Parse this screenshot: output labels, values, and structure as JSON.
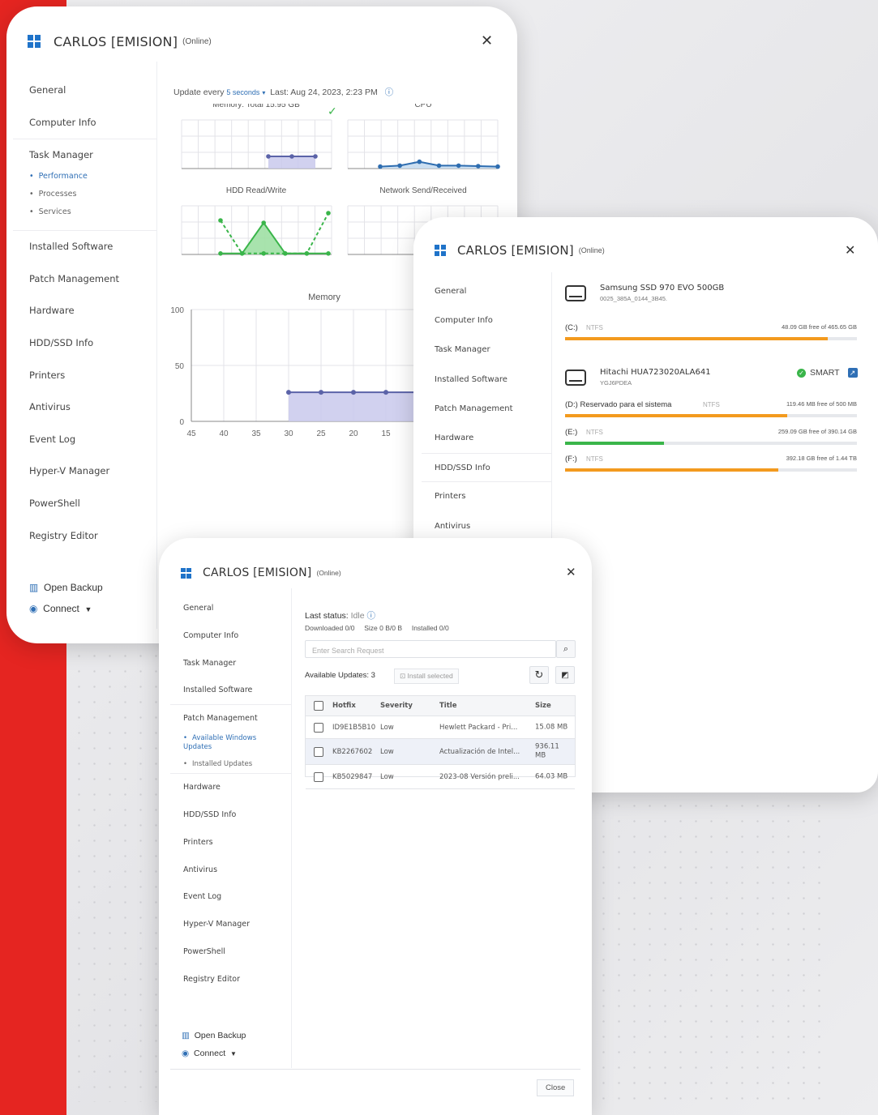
{
  "colors": {
    "brand_red": "#e52521",
    "accent_blue": "#2f6fb5",
    "chart_fill": "#c9c9ec",
    "chart_line": "#5b63a8",
    "hdd_green": "#3ab54a",
    "net_red": "#e84d6c",
    "bar_orange": "#f39a1e",
    "bar_green": "#3ab54a"
  },
  "windows": {
    "taskmgr": {
      "title": "CARLOS [EMISION]",
      "status": "(Online)",
      "close": "✕",
      "nav": [
        "General",
        "Computer Info",
        "Task Manager",
        "Installed Software",
        "Patch Management",
        "Hardware",
        "HDD/SSD Info",
        "Printers",
        "Antivirus",
        "Event Log",
        "Hyper-V Manager",
        "PowerShell",
        "Registry Editor"
      ],
      "sub": [
        "Performance",
        "Processes",
        "Services"
      ],
      "footer": {
        "backup": "Open Backup",
        "connect": "Connect"
      },
      "update_prefix": "Update every",
      "update_interval": "5 seconds",
      "last_label": "Last: Aug 24, 2023, 2:23 PM",
      "charts": {
        "memory_small": "Memory: Total 15.95 GB",
        "cpu": "CPU",
        "hdd": "HDD Read/Write",
        "net": "Network Send/Received",
        "memory_big": "Memory"
      }
    },
    "hdd": {
      "title": "CARLOS [EMISION]",
      "status": "(Online)",
      "close": "✕",
      "nav": [
        "General",
        "Computer Info",
        "Task Manager",
        "Installed Software",
        "Patch Management",
        "Hardware",
        "HDD/SSD Info",
        "Printers",
        "Antivirus"
      ],
      "disks": [
        {
          "name": "Samsung SSD 970 EVO 500GB",
          "serial": "0025_385A_0144_3B45.",
          "smart": ""
        },
        {
          "name": "Hitachi HUA723020ALA641",
          "serial": "YGJ6PDEA",
          "smart": "SMART"
        }
      ],
      "partitions": [
        {
          "label": "(C:)",
          "fs": "NTFS",
          "free": "48.09 GB free of 465.65 GB",
          "used_pct": 90,
          "color": "#f39a1e"
        },
        {
          "label": "(D:) Reservado para el sistema",
          "fs": "NTFS",
          "free": "119.46 MB free of 500 MB",
          "used_pct": 76,
          "color": "#f39a1e"
        },
        {
          "label": "(E:)",
          "fs": "NTFS",
          "free": "259.09 GB free of 390.14 GB",
          "used_pct": 34,
          "color": "#3ab54a"
        },
        {
          "label": "(F:)",
          "fs": "NTFS",
          "free": "392.18 GB free of 1.44 TB",
          "used_pct": 73,
          "color": "#f39a1e"
        }
      ]
    },
    "patch": {
      "title": "CARLOS [EMISION]",
      "status": "(Online)",
      "close": "✕",
      "nav": [
        "General",
        "Computer Info",
        "Task Manager",
        "Installed Software",
        "Patch Management",
        "Hardware",
        "HDD/SSD Info",
        "Printers",
        "Antivirus",
        "Event Log",
        "Hyper-V Manager",
        "PowerShell",
        "Registry Editor"
      ],
      "sub": [
        "Available Windows Updates",
        "Installed Updates"
      ],
      "footer": {
        "backup": "Open Backup",
        "connect": "Connect"
      },
      "last_status_label": "Last status:",
      "last_status_value": "Idle",
      "downloaded": "Downloaded 0/0",
      "size": "Size 0 B/0 B",
      "installed": "Installed 0/0",
      "search_placeholder": "Enter Search Request",
      "available_label": "Available Updates: 3",
      "install_selected": "Install selected",
      "columns": [
        "Hotfix",
        "Severity",
        "Title",
        "Size"
      ],
      "rows": [
        {
          "hotfix": "ID9E1B5B10",
          "severity": "Low",
          "title": "Hewlett Packard - Pri...",
          "size": "15.08 MB"
        },
        {
          "hotfix": "KB2267602",
          "severity": "Low",
          "title": "Actualización de Intel...",
          "size": "936.11 MB"
        },
        {
          "hotfix": "KB5029847",
          "severity": "Low",
          "title": "2023-08 Versión preli...",
          "size": "64.03 MB"
        }
      ],
      "close_button": "Close"
    }
  },
  "chart_data": [
    {
      "type": "area",
      "title": "Memory: Total 15.95 GB",
      "x": [
        1,
        2,
        3,
        4,
        5,
        6
      ],
      "values": [
        null,
        null,
        null,
        25,
        25,
        25
      ],
      "ylim": [
        0,
        100
      ]
    },
    {
      "type": "line",
      "title": "CPU",
      "x": [
        1,
        2,
        3,
        4,
        5,
        6,
        7
      ],
      "values": [
        4,
        6,
        14,
        6,
        6,
        5,
        4
      ],
      "ylim": [
        0,
        100
      ]
    },
    {
      "type": "line",
      "title": "HDD Read/Write",
      "x": [
        1,
        2,
        3,
        4,
        5,
        6
      ],
      "series": [
        {
          "values": [
            70,
            2,
            2,
            2,
            2,
            85
          ]
        },
        {
          "values": [
            2,
            2,
            65,
            2,
            2,
            2
          ]
        }
      ],
      "ylim": [
        0,
        100
      ]
    },
    {
      "type": "line",
      "title": "Network Send/Received",
      "x": [
        1,
        2,
        3
      ],
      "values": [
        null,
        3,
        8
      ],
      "ylim": [
        0,
        100
      ]
    },
    {
      "type": "area",
      "title": "Memory",
      "x": [
        45,
        40,
        35,
        30,
        25,
        20,
        15
      ],
      "values": [
        null,
        null,
        null,
        26,
        26,
        26,
        26
      ],
      "ylim": [
        0,
        100
      ],
      "yticks": [
        0,
        50,
        100
      ],
      "xticks": [
        45,
        40,
        35,
        30,
        25,
        20,
        15
      ]
    }
  ]
}
